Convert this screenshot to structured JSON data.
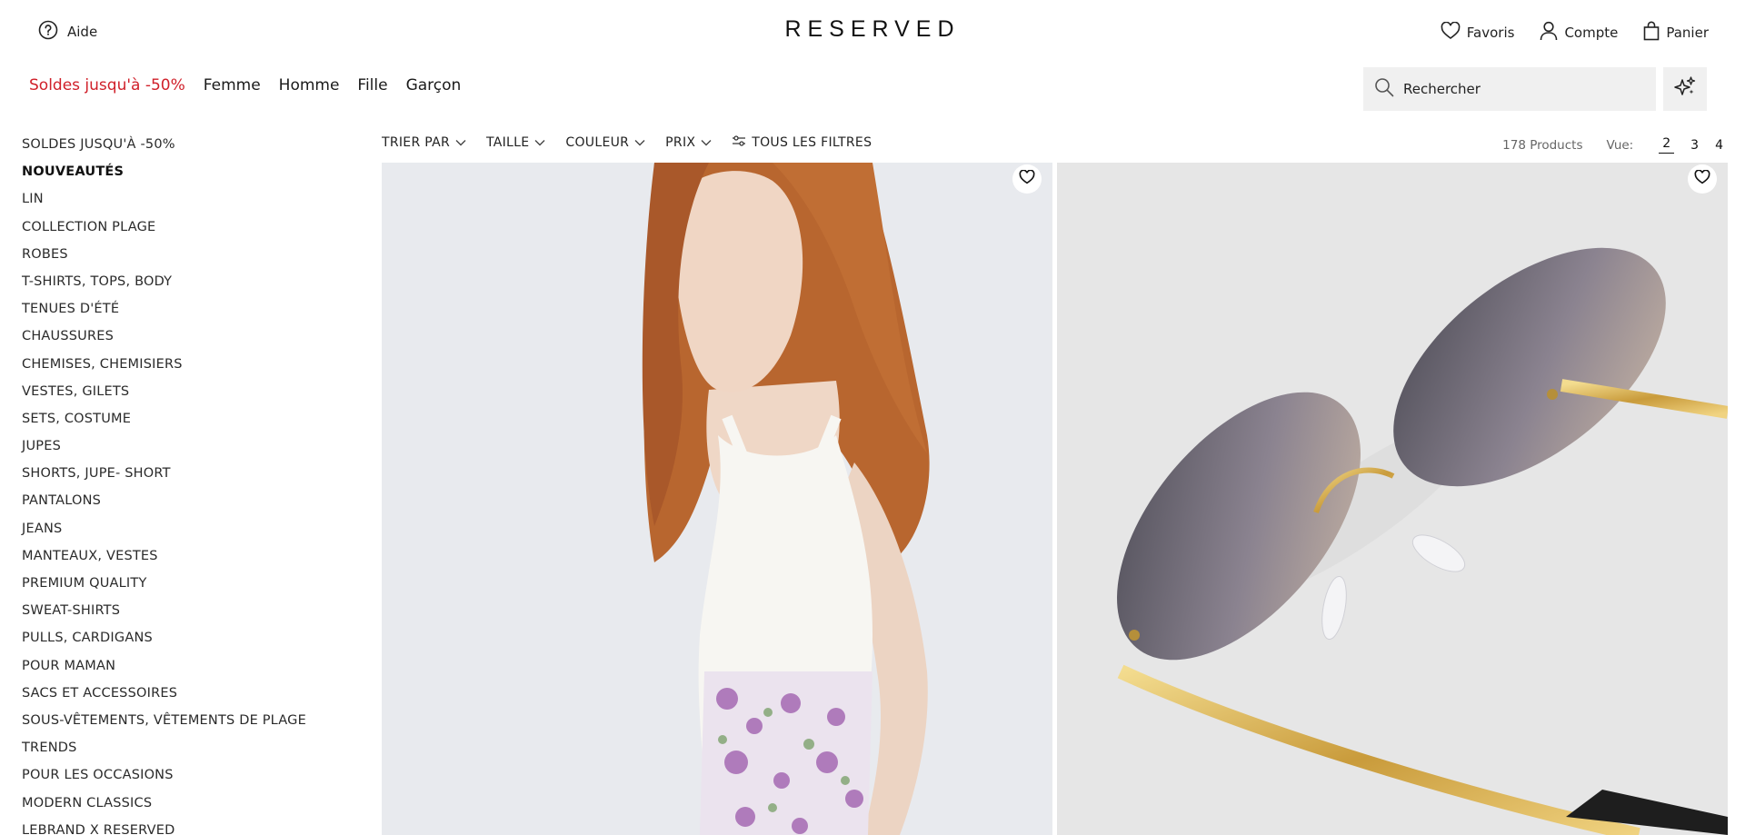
{
  "header": {
    "help_label": "Aide",
    "logo": "RESERVED",
    "favorites_label": "Favoris",
    "account_label": "Compte",
    "cart_label": "Panier"
  },
  "nav": {
    "items": [
      {
        "label": "Soldes jusqu'à -50%",
        "sale": true
      },
      {
        "label": "Femme"
      },
      {
        "label": "Homme"
      },
      {
        "label": "Fille"
      },
      {
        "label": "Garçon"
      }
    ]
  },
  "search": {
    "placeholder": "Rechercher",
    "icon": "search-icon"
  },
  "ai_button": {
    "icon": "sparkle-icon"
  },
  "sidebar": {
    "categories": [
      "SOLDES JUSQU'À -50%",
      "NOUVEAUTÉS",
      "LIN",
      "COLLECTION PLAGE",
      "ROBES",
      "T-SHIRTS, TOPS, BODY",
      "TENUES D'ÉTÉ",
      "CHAUSSURES",
      "CHEMISES, CHEMISIERS",
      "VESTES, GILETS",
      "SETS, COSTUME",
      "JUPES",
      "SHORTS, JUPE- SHORT",
      "PANTALONS",
      "JEANS",
      "MANTEAUX, VESTES",
      "PREMIUM QUALITY",
      "SWEAT-SHIRTS",
      "PULLS, CARDIGANS",
      "POUR MAMAN",
      "SACS ET ACCESSOIRES",
      "SOUS-VÊTEMENTS, VÊTEMENTS DE PLAGE",
      "TRENDS",
      "POUR LES OCCASIONS",
      "MODERN CLASSICS",
      "LEBRAND X RESERVED"
    ],
    "active_index": 1
  },
  "filters": {
    "sort": "TRIER PAR",
    "size": "TAILLE",
    "color": "COULEUR",
    "price": "PRIX",
    "all_filters": "TOUS LES FILTRES"
  },
  "results": {
    "count": "178 Products",
    "view_label": "Vue:",
    "views": [
      "2",
      "3",
      "4"
    ],
    "active_view": "2"
  },
  "products": [
    {
      "image": "woman-white-halter-top-floral-skirt",
      "favorite_icon": "heart-icon"
    },
    {
      "image": "gold-rimless-gradient-sunglasses",
      "favorite_icon": "heart-icon"
    }
  ],
  "colors": {
    "sale_red": "#d0202a",
    "text": "#1a1a1a",
    "search_bg": "#f0f0f0"
  }
}
